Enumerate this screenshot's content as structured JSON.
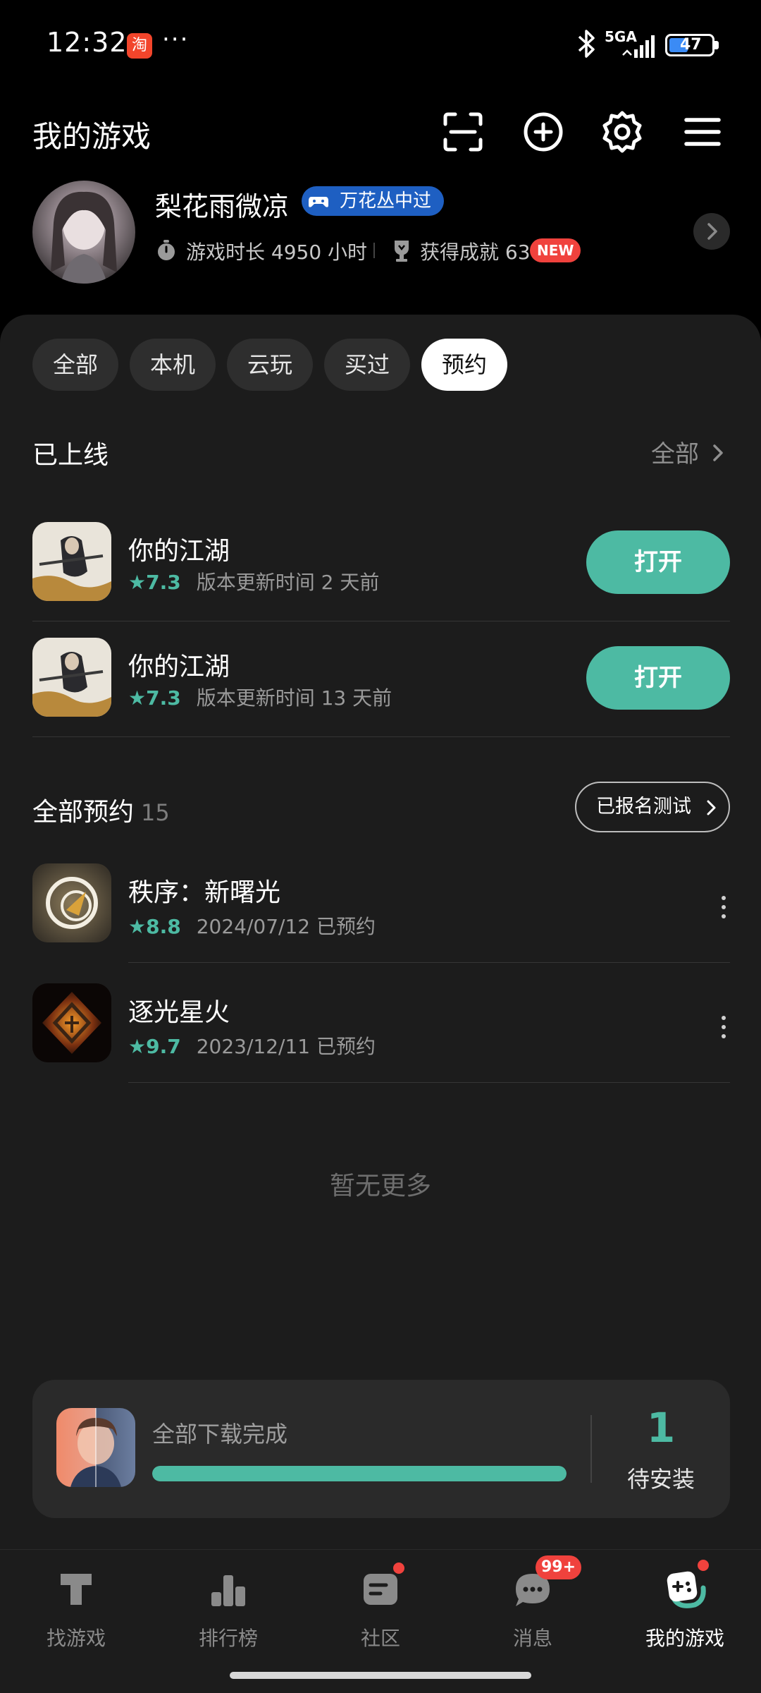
{
  "status_bar": {
    "time": "12:32",
    "app_icon_text": "淘",
    "dots": "···",
    "network": "5GA",
    "battery": "47"
  },
  "header": {
    "title": "我的游戏",
    "icons": [
      "scan-icon",
      "add-circle-icon",
      "settings-icon",
      "menu-icon"
    ]
  },
  "profile": {
    "username": "梨花雨微凉",
    "badge": "万花丛中过",
    "play_time": "游戏时长 4950 小时",
    "achievements": "获得成就 63",
    "new_tag": "NEW"
  },
  "filters": {
    "chips": [
      "全部",
      "本机",
      "云玩",
      "买过",
      "预约"
    ],
    "active_index": 4
  },
  "online_section": {
    "title": "已上线",
    "more": "全部",
    "games": [
      {
        "name": "你的江湖",
        "rating": "7.3",
        "meta": "版本更新时间 2 天前",
        "button": "打开"
      },
      {
        "name": "你的江湖",
        "rating": "7.3",
        "meta": "版本更新时间 13 天前",
        "button": "打开"
      }
    ]
  },
  "reservation_section": {
    "title": "全部预约",
    "count": "15",
    "signup_button": "已报名测试",
    "games": [
      {
        "name": "秩序：新曙光",
        "rating": "8.8",
        "meta": "2024/07/12 已预约"
      },
      {
        "name": "逐光星火",
        "rating": "9.7",
        "meta": "2023/12/11 已预约"
      }
    ],
    "no_more": "暂无更多"
  },
  "download": {
    "text": "全部下载完成",
    "progress": 1.0,
    "count": "1",
    "label": "待安装"
  },
  "bottom_nav": {
    "items": [
      "找游戏",
      "排行榜",
      "社区",
      "消息",
      "我的游戏"
    ],
    "active_index": 4,
    "message_badge": "99+"
  },
  "colors": {
    "accent": "#4dbaa3",
    "badge_blue": "#1e5fc2",
    "alert_red": "#f0423d"
  }
}
